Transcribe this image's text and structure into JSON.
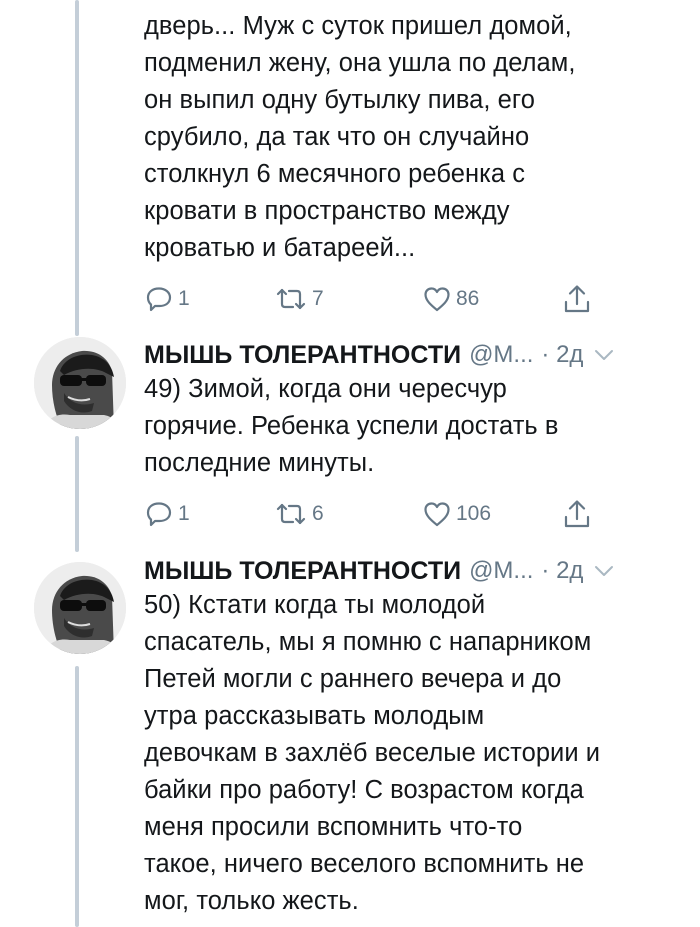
{
  "tweets": [
    {
      "text": "дверь... Муж с суток пришел домой,\nподменил жену, она ушла по делам,\nон выпил одну бутылку пива, его\nсрубило, да так что он случайно\nстолкнул 6 месячного ребенка с\nкровати в пространство между\nкроватью и батареей...",
      "replies": "1",
      "retweets": "7",
      "likes": "86"
    },
    {
      "author": "МЫШЬ ТОЛЕРАНТНОСТИ",
      "handle": "@М...",
      "time": "· 2д",
      "text": "49) Зимой, когда они чересчур\nгорячие. Ребенка успели достать в\nпоследние минуты.",
      "replies": "1",
      "retweets": "6",
      "likes": "106"
    },
    {
      "author": "МЫШЬ ТОЛЕРАНТНОСТИ",
      "handle": "@М...",
      "time": "· 2д",
      "text": "50) Кстати когда ты молодой\nспасатель, мы я помню с напарником\nПетей могли с раннего вечера и до\nутра рассказывать молодым\nдевочкам в захлёб веселые истории и\nбайки про работу! С возрастом когда\nменя просили вспомнить что-то\nтакое, ничего веселого вспомнить не\nмог, только жесть."
    }
  ],
  "icons": {
    "reply": "reply-icon",
    "retweet": "retweet-icon",
    "like": "heart-icon",
    "share": "share-icon",
    "chevron": "chevron-down-icon"
  },
  "colors": {
    "text": "#14171a",
    "secondary": "#657786",
    "thread_line": "#c4ced8"
  }
}
